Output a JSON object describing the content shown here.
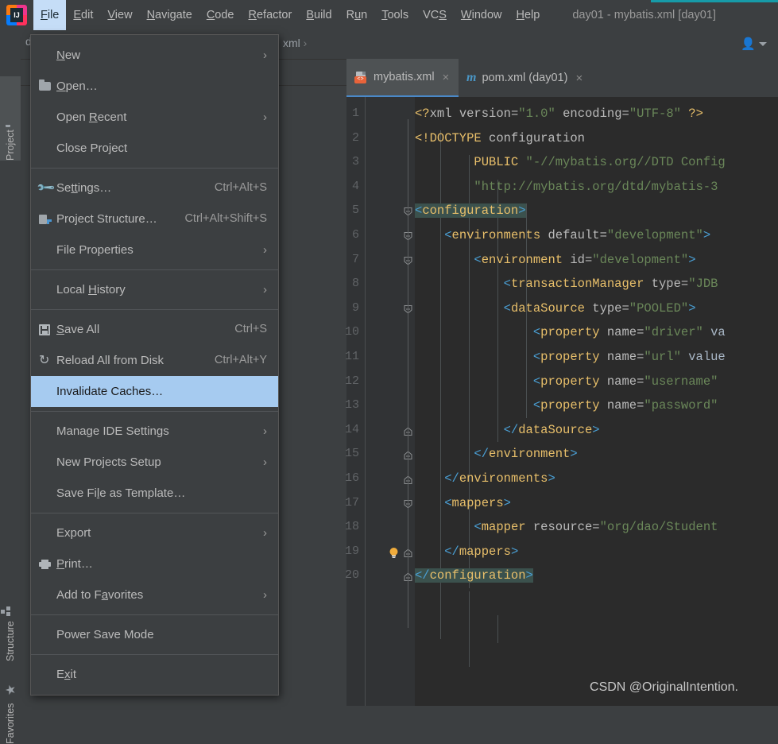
{
  "menubar": {
    "logo_text": "IJ",
    "items": [
      {
        "label": "File",
        "mnemonic": "F",
        "active": true
      },
      {
        "label": "Edit",
        "mnemonic": "E",
        "active": false
      },
      {
        "label": "View",
        "mnemonic": "V",
        "active": false
      },
      {
        "label": "Navigate",
        "mnemonic": "N",
        "active": false
      },
      {
        "label": "Code",
        "mnemonic": "C",
        "active": false
      },
      {
        "label": "Refactor",
        "mnemonic": "R",
        "active": false
      },
      {
        "label": "Build",
        "mnemonic": "B",
        "active": false
      },
      {
        "label": "Run",
        "mnemonic": "u",
        "active": false
      },
      {
        "label": "Tools",
        "mnemonic": "T",
        "active": false
      },
      {
        "label": "VCS",
        "mnemonic": "S",
        "active": false
      },
      {
        "label": "Window",
        "mnemonic": "W",
        "active": false
      },
      {
        "label": "Help",
        "mnemonic": "H",
        "active": false
      }
    ],
    "window_title": "day01 - mybatis.xml [day01]",
    "accent_color": "#179ba8"
  },
  "file_menu": {
    "highlight_color": "#a6cbf0",
    "items": [
      {
        "label": "New",
        "accel": "",
        "submenu": true,
        "icon": "",
        "highlighted": false
      },
      {
        "label": "Open…",
        "accel": "",
        "submenu": false,
        "icon": "folder-icon",
        "highlighted": false
      },
      {
        "label": "Open Recent",
        "accel": "",
        "submenu": true,
        "icon": "",
        "highlighted": false
      },
      {
        "label": "Close Project",
        "accel": "",
        "submenu": false,
        "icon": "",
        "highlighted": false
      },
      {
        "separator": true
      },
      {
        "label": "Settings…",
        "accel": "Ctrl+Alt+S",
        "submenu": false,
        "icon": "wrench-icon",
        "highlighted": false
      },
      {
        "label": "Project Structure…",
        "accel": "Ctrl+Alt+Shift+S",
        "submenu": false,
        "icon": "module-icon",
        "highlighted": false
      },
      {
        "label": "File Properties",
        "accel": "",
        "submenu": true,
        "icon": "",
        "highlighted": false
      },
      {
        "separator": true
      },
      {
        "label": "Local History",
        "accel": "",
        "submenu": true,
        "icon": "",
        "highlighted": false
      },
      {
        "separator": true
      },
      {
        "label": "Save All",
        "accel": "Ctrl+S",
        "submenu": false,
        "icon": "save-icon",
        "highlighted": false
      },
      {
        "label": "Reload All from Disk",
        "accel": "Ctrl+Alt+Y",
        "submenu": false,
        "icon": "reload-icon",
        "highlighted": false
      },
      {
        "label": "Invalidate Caches…",
        "accel": "",
        "submenu": false,
        "icon": "",
        "highlighted": true
      },
      {
        "separator": true
      },
      {
        "label": "Manage IDE Settings",
        "accel": "",
        "submenu": true,
        "icon": "",
        "highlighted": false
      },
      {
        "label": "New Projects Setup",
        "accel": "",
        "submenu": true,
        "icon": "",
        "highlighted": false
      },
      {
        "label": "Save File as Template…",
        "accel": "",
        "submenu": false,
        "icon": "",
        "highlighted": false
      },
      {
        "separator": true
      },
      {
        "label": "Export",
        "accel": "",
        "submenu": true,
        "icon": "",
        "highlighted": false
      },
      {
        "label": "Print…",
        "accel": "",
        "submenu": false,
        "icon": "print-icon",
        "highlighted": false
      },
      {
        "label": "Add to Favorites",
        "accel": "",
        "submenu": true,
        "icon": "",
        "highlighted": false
      },
      {
        "separator": true
      },
      {
        "label": "Power Save Mode",
        "accel": "",
        "submenu": false,
        "icon": "",
        "highlighted": false
      },
      {
        "separator": true
      },
      {
        "label": "Exit",
        "accel": "",
        "submenu": false,
        "icon": "",
        "highlighted": false
      }
    ]
  },
  "toolwindows": {
    "left": [
      {
        "label": "Project",
        "icon": "folder-icon",
        "selected": true
      },
      {
        "label": "Structure",
        "icon": "structure-icon",
        "selected": false
      },
      {
        "label": "Favorites",
        "icon": "star-icon",
        "selected": false
      }
    ]
  },
  "project_panel": {
    "breadcrumb": "da",
    "gear_icon": "gear-icon",
    "minimize_icon": "minimize-icon",
    "selected_row_color": "#0d2c48"
  },
  "editor": {
    "breadcrumb": "xml",
    "user_icon": "user-icon",
    "tabs": [
      {
        "label": "mybatis.xml",
        "icon": "xml-file-icon",
        "active": true,
        "close": "×"
      },
      {
        "label": "pom.xml (day01)",
        "icon": "maven-icon",
        "active": false,
        "close": "×"
      }
    ],
    "active_tab_underline": "#4a88c7",
    "lines": [
      {
        "n": "1",
        "fold": "",
        "bulb": false,
        "indent": 0
      },
      {
        "n": "2",
        "fold": "",
        "bulb": false,
        "indent": 0
      },
      {
        "n": "3",
        "fold": "",
        "bulb": false,
        "indent": 0
      },
      {
        "n": "4",
        "fold": "",
        "bulb": false,
        "indent": 0
      },
      {
        "n": "5",
        "fold": "open",
        "bulb": false,
        "indent": 0
      },
      {
        "n": "6",
        "fold": "open",
        "bulb": false,
        "indent": 1
      },
      {
        "n": "7",
        "fold": "open",
        "bulb": false,
        "indent": 2
      },
      {
        "n": "8",
        "fold": "",
        "bulb": false,
        "indent": 3
      },
      {
        "n": "9",
        "fold": "open",
        "bulb": false,
        "indent": 3
      },
      {
        "n": "10",
        "fold": "",
        "bulb": false,
        "indent": 4
      },
      {
        "n": "11",
        "fold": "",
        "bulb": false,
        "indent": 4
      },
      {
        "n": "12",
        "fold": "",
        "bulb": false,
        "indent": 4
      },
      {
        "n": "13",
        "fold": "",
        "bulb": false,
        "indent": 4
      },
      {
        "n": "14",
        "fold": "close",
        "bulb": false,
        "indent": 3
      },
      {
        "n": "15",
        "fold": "close",
        "bulb": false,
        "indent": 2
      },
      {
        "n": "16",
        "fold": "close",
        "bulb": false,
        "indent": 1
      },
      {
        "n": "17",
        "fold": "open",
        "bulb": false,
        "indent": 1
      },
      {
        "n": "18",
        "fold": "",
        "bulb": false,
        "indent": 2
      },
      {
        "n": "19",
        "fold": "close",
        "bulb": true,
        "indent": 1
      },
      {
        "n": "20",
        "fold": "close",
        "bulb": false,
        "indent": 0
      }
    ],
    "code_text": [
      "<?xml version=\"1.0\" encoding=\"UTF-8\" ?>",
      "<!DOCTYPE configuration",
      "        PUBLIC \"-//mybatis.org//DTD Config",
      "        \"http://mybatis.org/dtd/mybatis-3",
      "<configuration>",
      "    <environments default=\"development\">",
      "        <environment id=\"development\">",
      "            <transactionManager type=\"JDB",
      "            <dataSource type=\"POOLED\">",
      "                <property name=\"driver\" va",
      "                <property name=\"url\" value",
      "                <property name=\"username\"",
      "                <property name=\"password\"",
      "            </dataSource>",
      "        </environment>",
      "    </environments>",
      "    <mappers>",
      "        <mapper resource=\"org/dao/Student",
      "    </mappers>",
      "</configuration>"
    ],
    "theme": {
      "background": "#2b2b2b",
      "gutter_background": "#313335",
      "line_number_color": "#606366",
      "tag_color": "#e8bf6a",
      "bracket_color": "#4a9fd4",
      "attribute_color": "#bababa",
      "string_color": "#6a8759",
      "brace_match_highlight": "#3b514d"
    }
  },
  "watermark": "CSDN @OriginalIntention."
}
